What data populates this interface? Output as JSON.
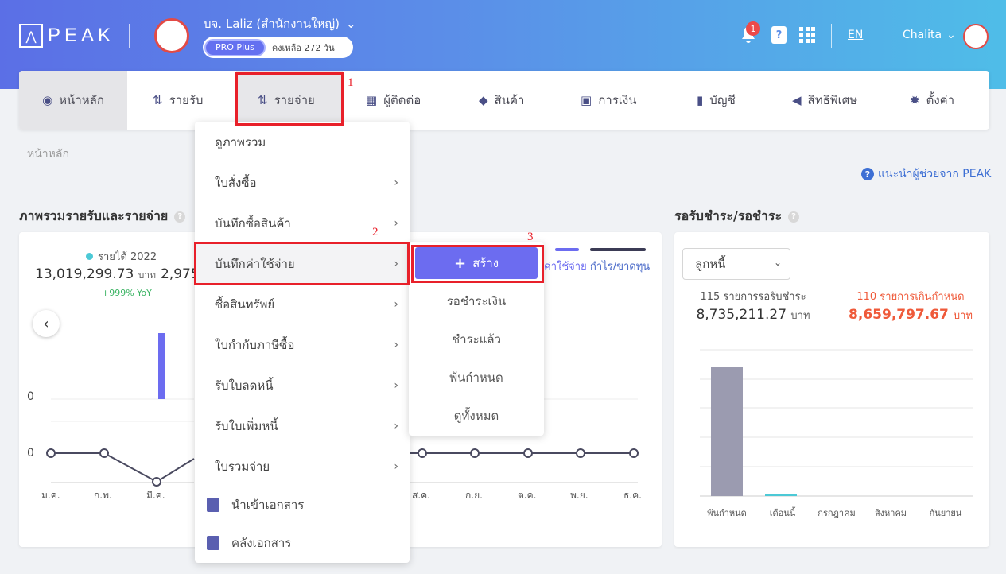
{
  "header": {
    "logo": "PEAK",
    "company_name": "บจ. Laliz (สำนักงานใหญ่)",
    "plan": "PRO Plus",
    "plan_remaining": "คงเหลือ 272 วัน",
    "notification_count": "1",
    "language": "EN",
    "user_name": "Chalita"
  },
  "nav": {
    "home": "หน้าหลัก",
    "income": "รายรับ",
    "expense": "รายจ่าย",
    "contacts": "ผู้ติดต่อ",
    "products": "สินค้า",
    "finance": "การเงิน",
    "accounts": "บัญชี",
    "privileges": "สิทธิพิเศษ",
    "settings": "ตั้งค่า"
  },
  "annotations": {
    "step1": "1",
    "step2": "2",
    "step3": "3"
  },
  "breadcrumb": "หน้าหลัก",
  "help_link": "แนะนำผู้ช่วยจาก PEAK",
  "overview": {
    "title": "ภาพรวมรายรับและรายจ่าย",
    "legend_income": "รายได้ 2022",
    "income_value": "13,019,299.73",
    "currency": "บาท",
    "yoy": "+999% YoY",
    "second_value_partial": "2,975",
    "legend_expense_partial": "ค่าใช้จ่าย",
    "legend_profit": "กำไร/ขาดทุน",
    "zero": "0",
    "months": [
      "ม.ค.",
      "ก.พ.",
      "มี.ค.",
      "ส.ค.",
      "ก.ย.",
      "ต.ค.",
      "พ.ย.",
      "ธ.ค."
    ]
  },
  "expense_menu": {
    "items": [
      "ดูภาพรวม",
      "ใบสั่งซื้อ",
      "บันทึกซื้อสินค้า",
      "บันทึกค่าใช้จ่าย",
      "ซื้อสินทรัพย์",
      "ใบกำกับภาษีซื้อ",
      "รับใบลดหนี้",
      "รับใบเพิ่มหนี้",
      "ใบรวมจ่าย"
    ],
    "import_doc": "นำเข้าเอกสาร",
    "doc_storage": "คลังเอกสาร"
  },
  "submenu": {
    "create": "สร้าง",
    "items": [
      "รอชำระเงิน",
      "ชำระแล้ว",
      "พ้นกำหนด",
      "ดูทั้งหมด"
    ]
  },
  "receivables": {
    "title": "รอรับชำระ/รอชำระ",
    "select": "ลูกหนี้",
    "pending_label": "115 รายการรอรับชำระ",
    "pending_value": "8,735,211.27",
    "overdue_label": "110 รายการเกินกำหนด",
    "overdue_value": "8,659,797.67",
    "currency": "บาท",
    "overdue_color": "#ef5a3a",
    "categories": [
      "พ้นกำหนด",
      "เดือนนี้",
      "กรกฎาคม",
      "สิงหาคม",
      "กันยายน"
    ]
  },
  "chart_data": [
    {
      "type": "bar",
      "categories": [
        "พ้นกำหนด",
        "เดือนนี้",
        "กรกฎาคม",
        "สิงหาคม",
        "กันยายน"
      ],
      "values": [
        8659797.67,
        75413.6,
        0,
        0,
        0
      ]
    }
  ]
}
